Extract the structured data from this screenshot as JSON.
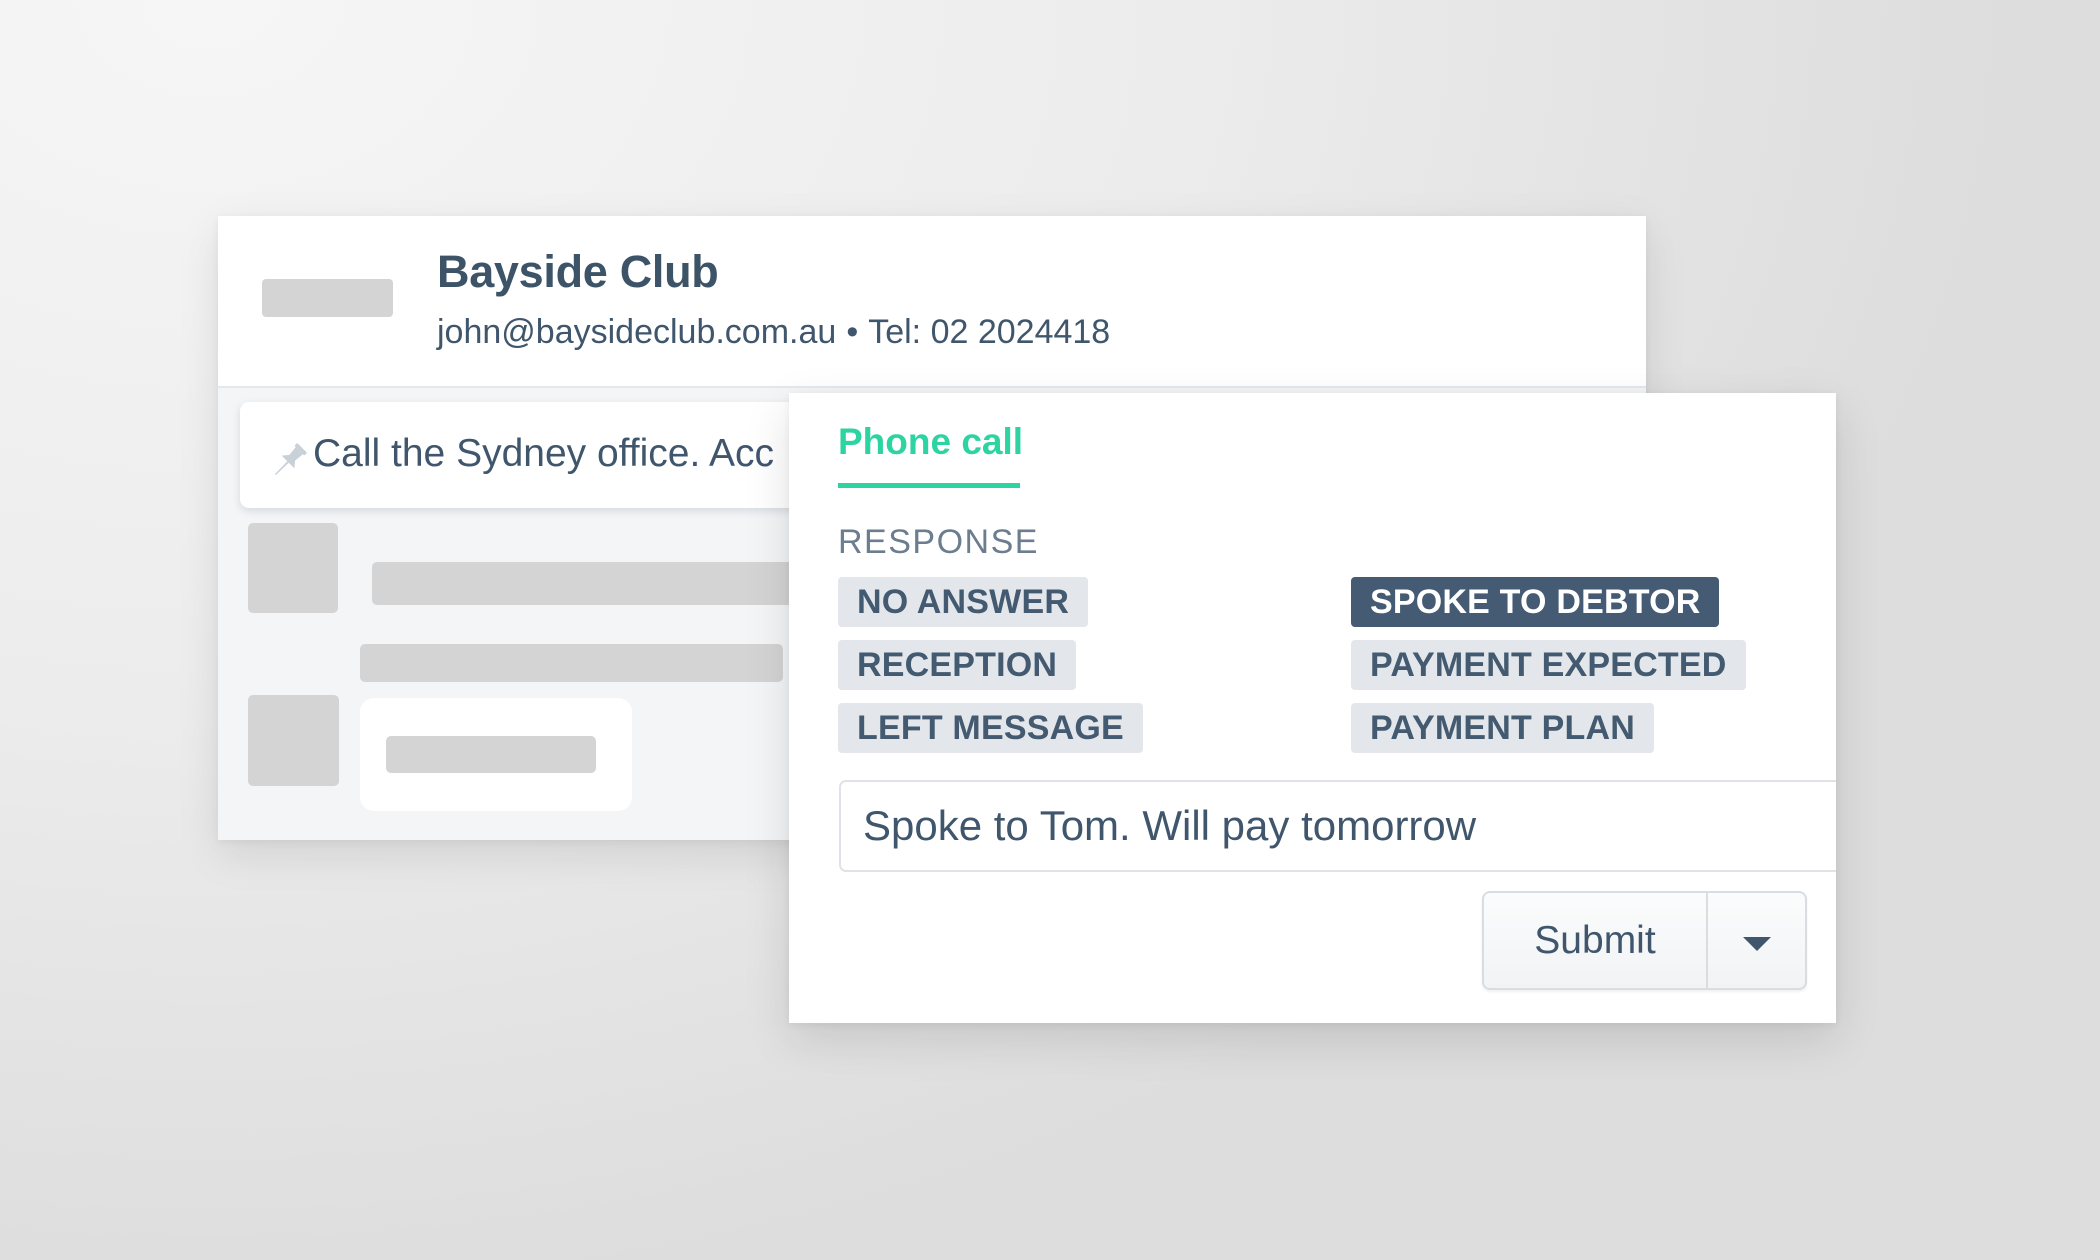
{
  "contact": {
    "name": "Bayside Club",
    "email": "john@baysideclub.com.au",
    "separator": "•",
    "phone": "Tel: 02 2024418",
    "pinned_note": "Call the Sydney office. Acc",
    "pin_icon": "pushpin-icon"
  },
  "call_panel": {
    "tab_label": "Phone call",
    "accent_color": "#2ed3a2",
    "response_label": "RESPONSE",
    "responses": [
      {
        "label": "NO ANSWER",
        "selected": false
      },
      {
        "label": "RECEPTION",
        "selected": false
      },
      {
        "label": "LEFT MESSAGE",
        "selected": false
      },
      {
        "label": "SPOKE TO DEBTOR",
        "selected": true
      },
      {
        "label": "PAYMENT EXPECTED",
        "selected": false
      },
      {
        "label": "PAYMENT PLAN",
        "selected": false
      }
    ],
    "note_value": "Spoke to Tom. Will pay tomorrow",
    "submit_label": "Submit",
    "dropdown_icon": "caret-down-icon",
    "selected_chip_color": "#455b73"
  }
}
